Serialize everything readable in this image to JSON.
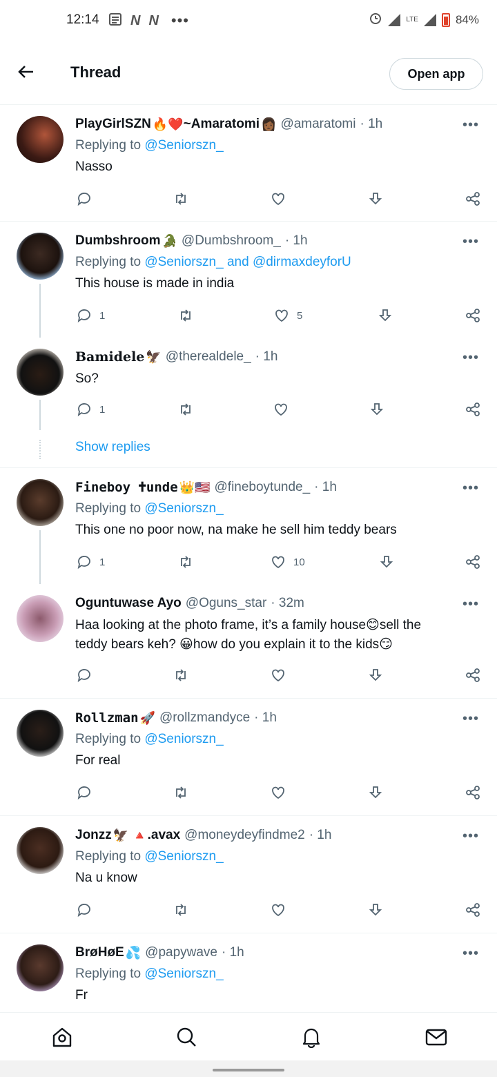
{
  "status_bar": {
    "time": "12:14",
    "left_icons": [
      "news-icon",
      "n-icon",
      "n-icon",
      "more-dots"
    ],
    "lte": "LTE",
    "battery": "84%",
    "battery_color": "#e0422a"
  },
  "header": {
    "title": "Thread",
    "open_app": "Open app"
  },
  "colors": {
    "link": "#1d9bf0",
    "secondary": "#536471",
    "text": "#0f1419"
  },
  "replying_label": "Replying to",
  "and_label": "and",
  "tweets": [
    {
      "name": "PlayGirlSZN",
      "emoji": "🔥❤️",
      "name_suffix": "~Amaratomi",
      "emoji2": "👩🏾",
      "handle": "@amaratomi",
      "time": "· 1h",
      "reply_to": "@Seniorszn_",
      "text": "Nasso",
      "replies": "",
      "likes": ""
    },
    {
      "name": "Dumbshroom",
      "emoji": "🐊",
      "handle": "@Dumbshroom_",
      "time": "· 1h",
      "reply_to": "@Seniorszn_",
      "reply_to2": "@dirmaxdeyforU",
      "text": "This house is made in india",
      "replies": "1",
      "likes": "5"
    },
    {
      "name": "Bamidele",
      "emoji": "🦅",
      "handle": "@therealdele_",
      "time": "· 1h",
      "text": "So?",
      "replies": "1",
      "likes": ""
    },
    {
      "name": "Fineboy 🕇unde",
      "emoji": "👑🇺🇸",
      "handle": "@fineboytunde_",
      "time": "· 1h",
      "reply_to": "@Seniorszn_",
      "text": "This one no poor now, na make he sell him teddy bears",
      "replies": "1",
      "likes": "10"
    },
    {
      "name": "Oguntuwase Ayo",
      "emoji": "",
      "handle": "@Oguns_star",
      "time": "· 32m",
      "text_line1": "Haa looking at the photo frame, it’s a family house😊sell the",
      "text_line2": "teddy bears keh? 😀how do you explain it to the kids😏",
      "replies": "",
      "likes": ""
    },
    {
      "name": "Rollzman",
      "emoji": "🚀",
      "handle": "@rollzmandyce",
      "time": "· 1h",
      "reply_to": "@Seniorszn_",
      "text": "For real",
      "replies": "",
      "likes": ""
    },
    {
      "name": "Jonzz",
      "emoji": "🦅 🔺",
      "name_suffix": ".avax",
      "handle": "@moneydeyfindme2",
      "time": "· 1h",
      "reply_to": "@Seniorszn_",
      "text": "Na u know",
      "replies": "",
      "likes": ""
    },
    {
      "name": "BrøHøE",
      "emoji": "💦",
      "handle": "@papywave",
      "time": "· 1h",
      "reply_to": "@Seniorszn_",
      "text": "Fr"
    }
  ],
  "show_replies": "Show replies",
  "bottom_nav": [
    "home-icon",
    "search-icon",
    "bell-icon",
    "mail-icon"
  ]
}
